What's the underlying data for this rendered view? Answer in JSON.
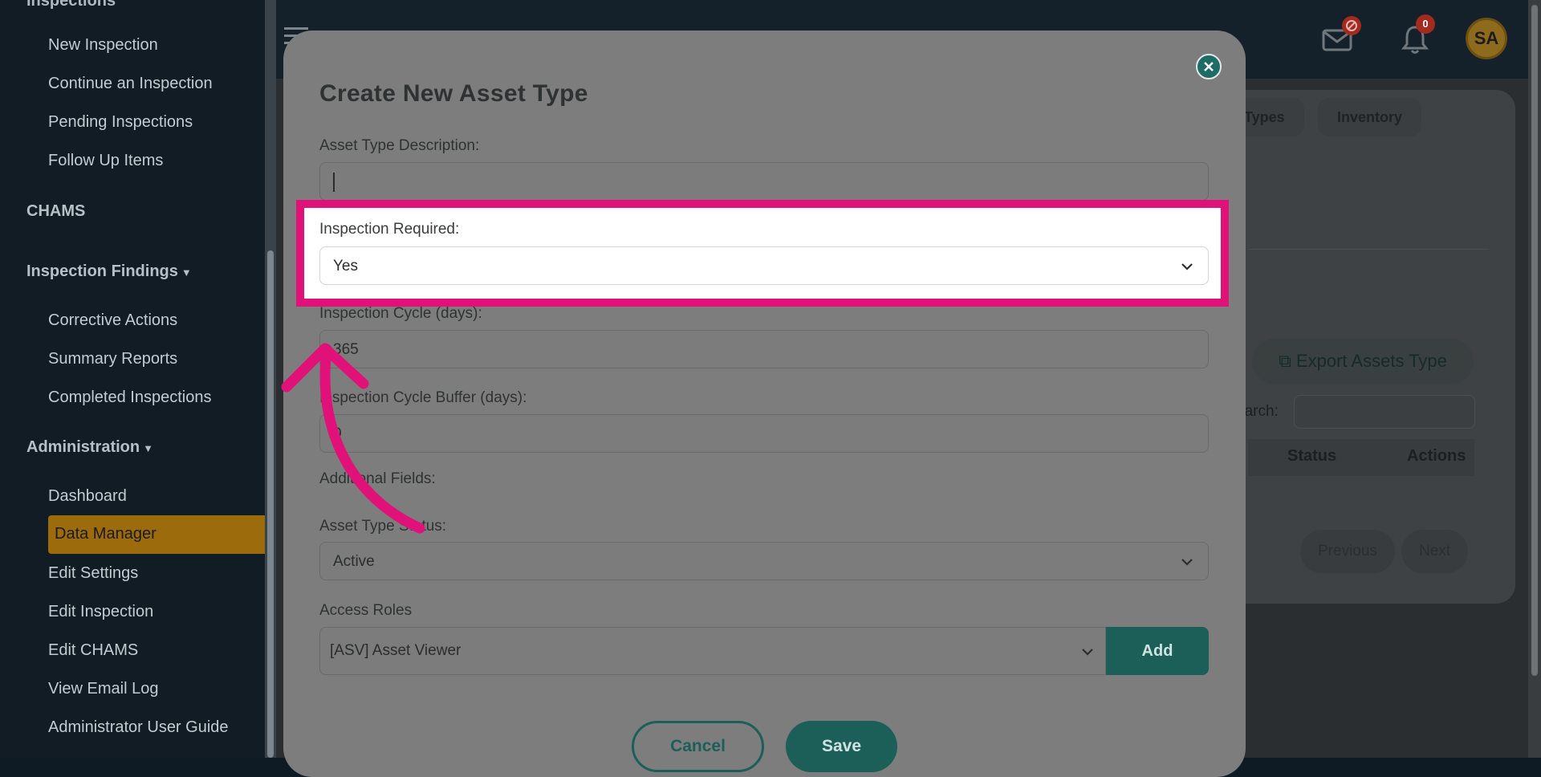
{
  "sidebar": {
    "cut_heading": "Inspections",
    "links_top": [
      "New Inspection",
      "Continue an Inspection",
      "Pending Inspections",
      "Follow Up Items"
    ],
    "section_chams": "CHAMS",
    "section_findings": "Inspection Findings",
    "links_findings": [
      "Corrective Actions",
      "Summary Reports",
      "Completed Inspections"
    ],
    "section_admin": "Administration",
    "links_admin": [
      "Dashboard",
      "Data Manager",
      "Edit Settings",
      "Edit Inspection",
      "Edit CHAMS",
      "View Email Log",
      "Administrator User Guide"
    ],
    "active_item": "Data Manager"
  },
  "header": {
    "mail_badge": "",
    "bell_badge": "0",
    "avatar_initials": "SA"
  },
  "background": {
    "tabs": [
      "p Types",
      "Inventory"
    ],
    "export_label": "Export Assets Type",
    "search_label": "earch:",
    "columns": [
      "Status",
      "Actions"
    ],
    "prev_label": "Previous",
    "next_label": "Next"
  },
  "modal": {
    "title": "Create New Asset Type",
    "description_label": "Asset Type Description:",
    "description_value": "",
    "inspection_required_label": "Inspection Required:",
    "inspection_required_value": "Yes",
    "cycle_label": "Inspection Cycle (days):",
    "cycle_value": "365",
    "buffer_label": "Inspection Cycle Buffer (days):",
    "buffer_value": "0",
    "additional_fields_label": "Additional Fields:",
    "status_label": "Asset Type Status:",
    "status_value": "Active",
    "access_roles_label": "Access Roles",
    "access_role_value": "[ASV] Asset Viewer",
    "add_label": "Add",
    "cancel_label": "Cancel",
    "save_label": "Save"
  },
  "colors": {
    "highlight": "#e0127a",
    "accent": "#1c5f59",
    "active_nav": "#9c6b0c"
  }
}
